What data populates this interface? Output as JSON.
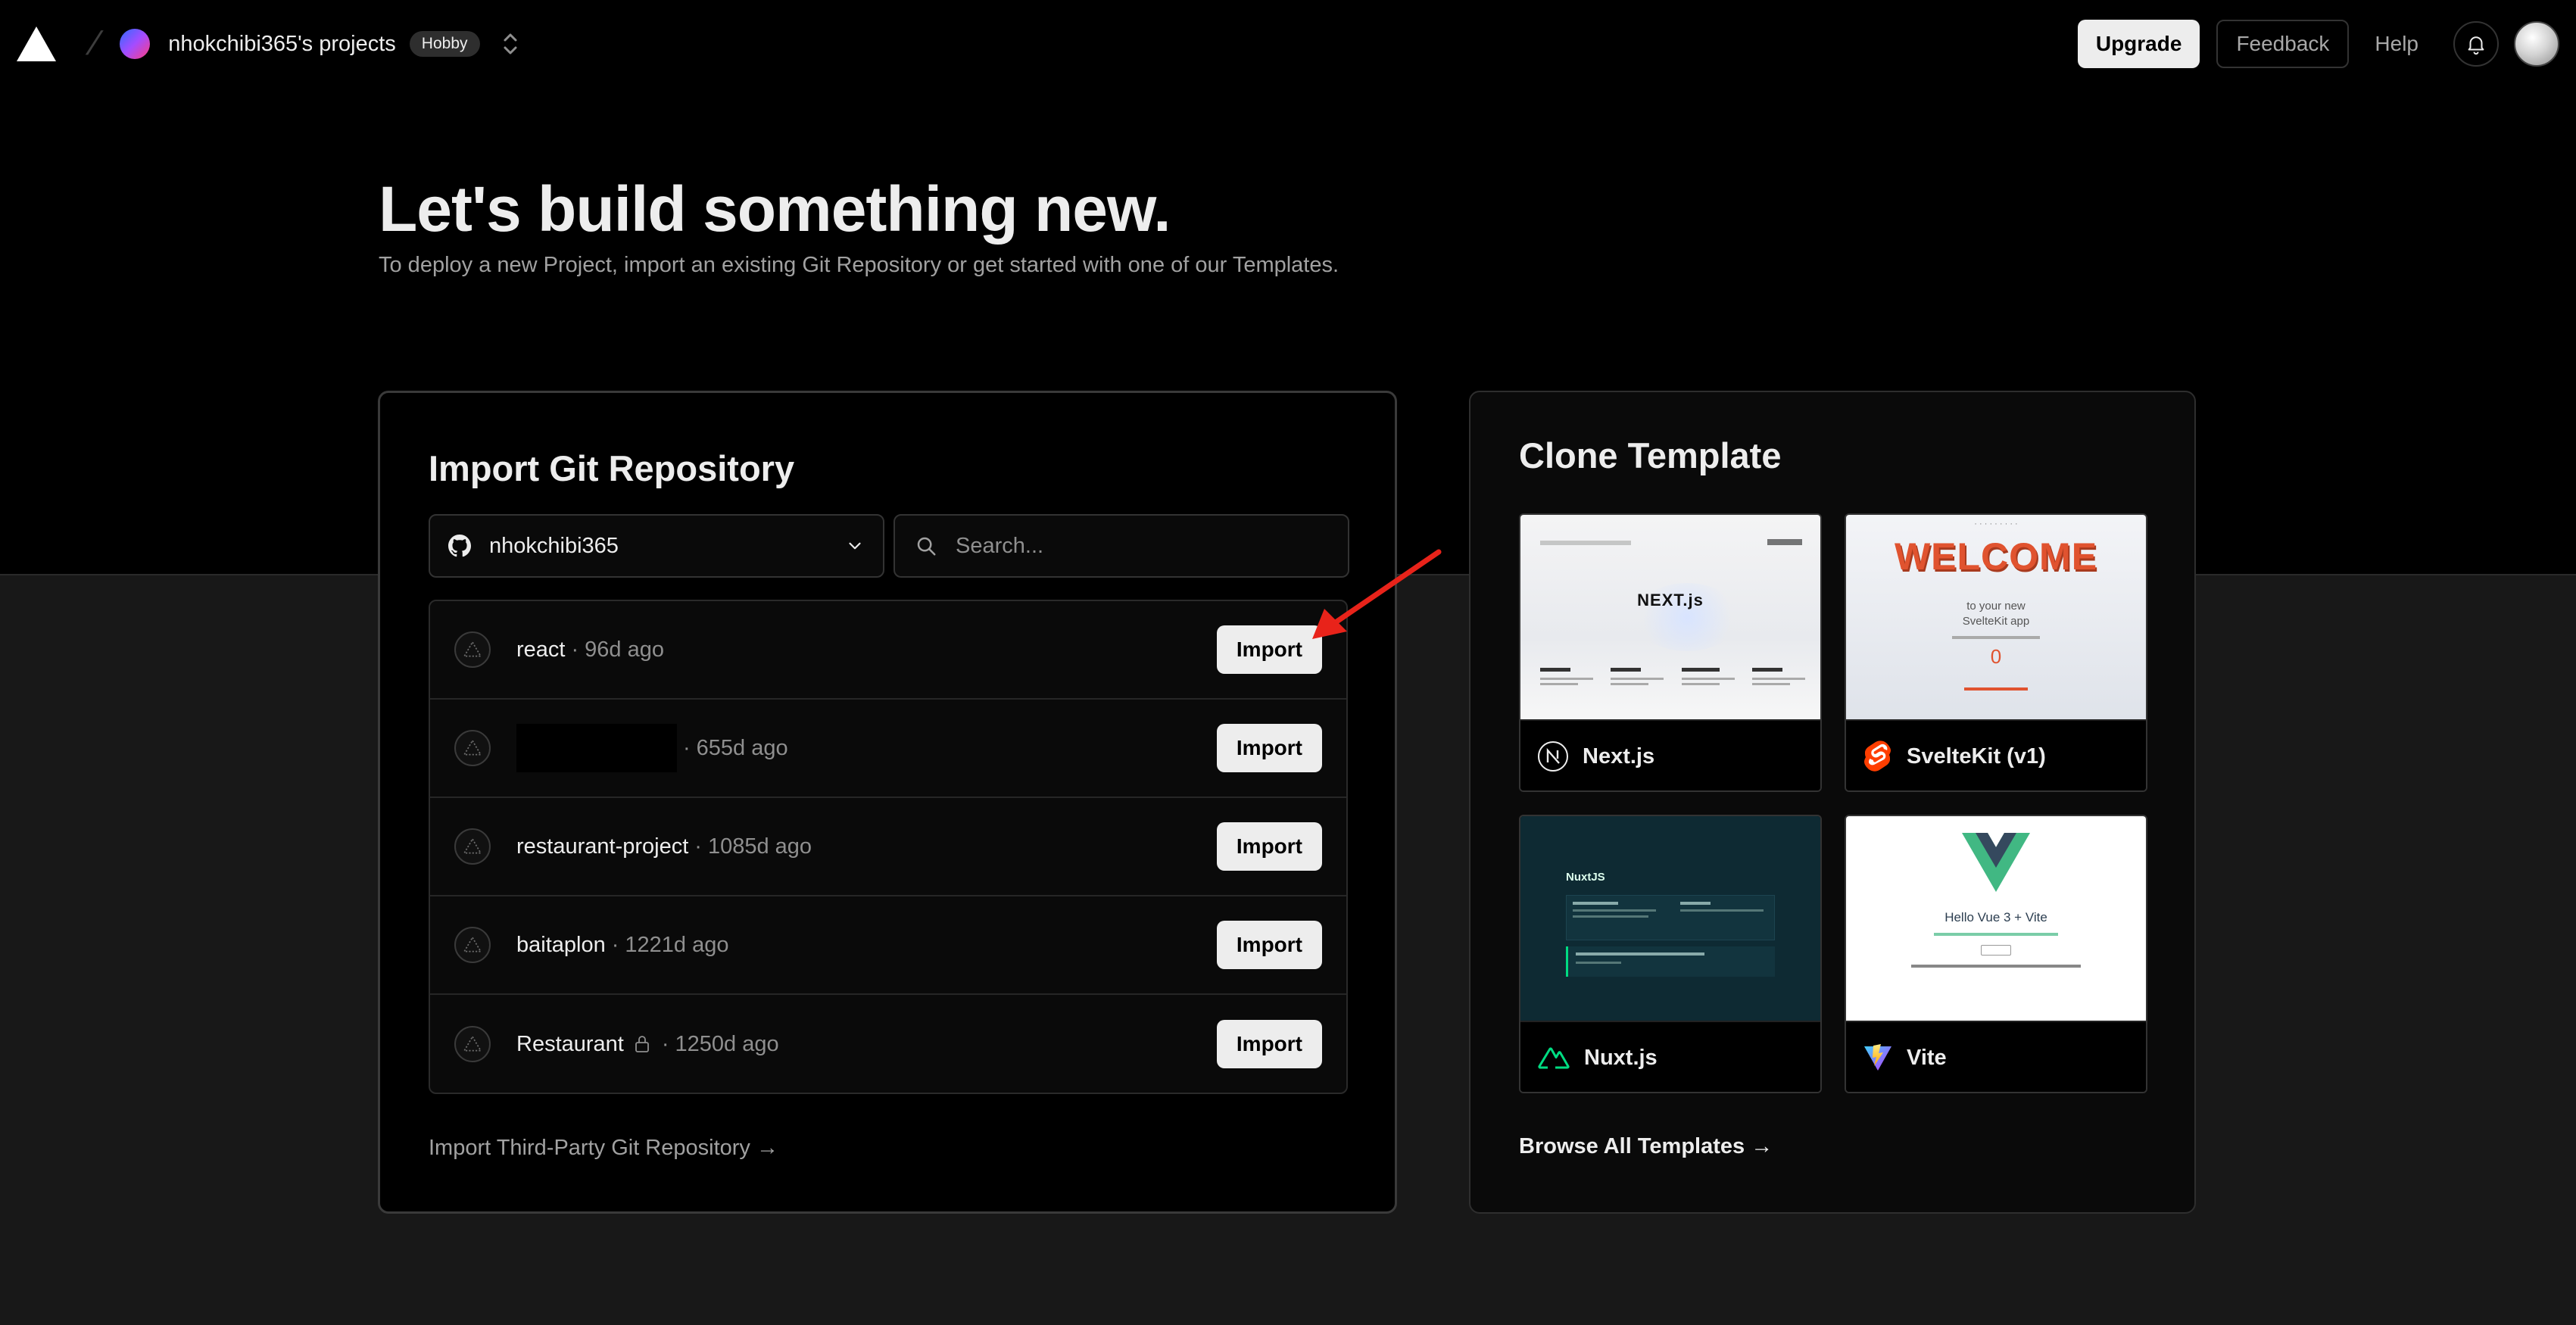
{
  "header": {
    "team_name": "nhokchibi365's projects",
    "plan_badge": "Hobby",
    "upgrade_label": "Upgrade",
    "feedback_label": "Feedback",
    "help_label": "Help",
    "icons": [
      "vercel-logo-icon",
      "chevron-up-down-icon",
      "bell-icon",
      "user-avatar"
    ]
  },
  "hero": {
    "title": "Let's build something new.",
    "subtitle": "To deploy a new Project, import an existing Git Repository or get started with one of our Templates."
  },
  "import": {
    "title": "Import Git Repository",
    "account": "nhokchibi365",
    "search_placeholder": "Search...",
    "separator": "·",
    "repos": [
      {
        "name": "react",
        "age": "96d ago",
        "private": false,
        "redacted": false
      },
      {
        "name": "",
        "age": "655d ago",
        "private": false,
        "redacted": true
      },
      {
        "name": "restaurant-project",
        "age": "1085d ago",
        "private": false,
        "redacted": false
      },
      {
        "name": "baitaplon",
        "age": "1221d ago",
        "private": false,
        "redacted": false
      },
      {
        "name": "Restaurant",
        "age": "1250d ago",
        "private": true,
        "redacted": false
      }
    ],
    "import_label": "Import",
    "third_party_link": "Import Third-Party Git Repository →"
  },
  "templates": {
    "title": "Clone Template",
    "items": [
      {
        "name": "Next.js",
        "icon": "nextjs-icon"
      },
      {
        "name": "SvelteKit (v1)",
        "icon": "svelte-icon"
      },
      {
        "name": "Nuxt.js",
        "icon": "nuxt-icon"
      },
      {
        "name": "Vite",
        "icon": "vite-icon"
      }
    ],
    "browse_all": "Browse All Templates →",
    "previews": {
      "nextjs_wordmark": "NEXT.js",
      "svelte_welcome": "WELCOME",
      "svelte_line1": "to your new",
      "svelte_line2": "SvelteKit app",
      "svelte_counter": "0",
      "nuxt_brand": "NuxtJS",
      "vite_heading": "Hello Vue 3 + Vite"
    }
  },
  "colors": {
    "accent_red_arrow": "#e8231a",
    "page_black": "#000000",
    "page_dark": "#181818",
    "button_light": "#ededed"
  }
}
